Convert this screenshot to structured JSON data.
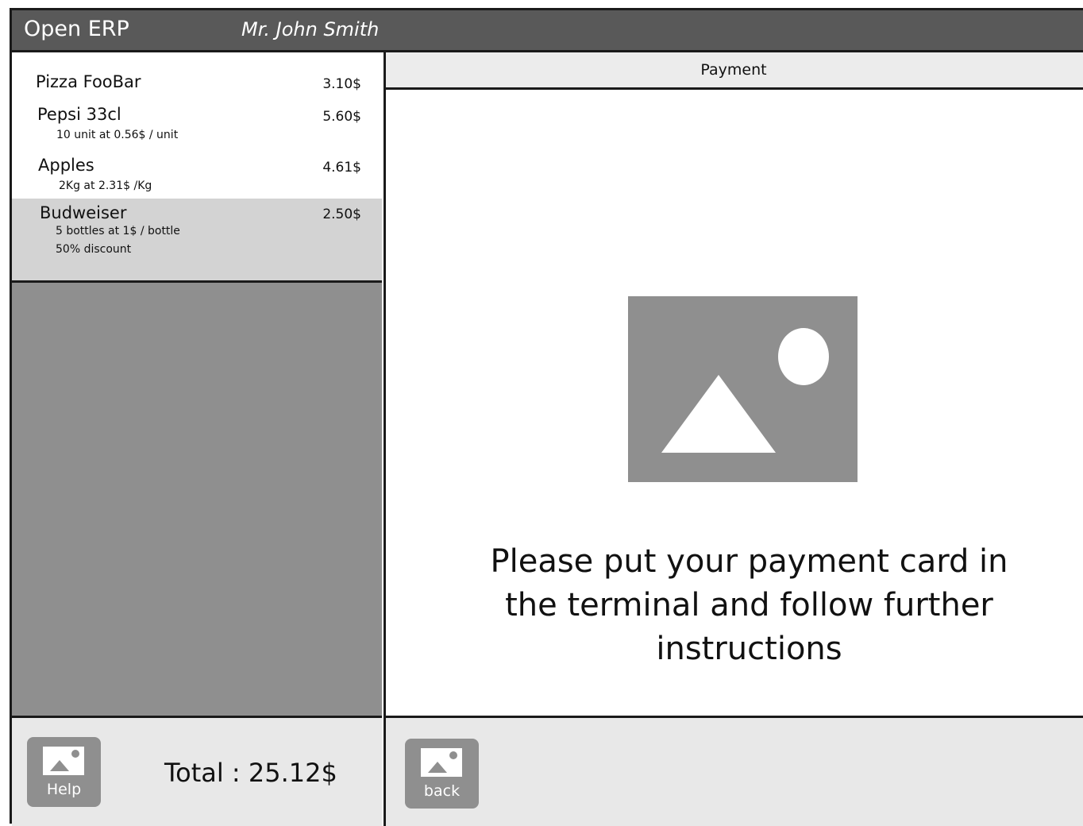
{
  "header": {
    "app_title": "Open ERP",
    "user_name": "Mr. John Smith"
  },
  "order": {
    "items": [
      {
        "name": "Pizza FooBar",
        "price": "3.10$",
        "details": []
      },
      {
        "name": "Pepsi 33cl",
        "price": "5.60$",
        "details": [
          "10 unit at 0.56$ / unit"
        ]
      },
      {
        "name": "Apples",
        "price": "4.61$",
        "details": [
          "2Kg at 2.31$ /Kg"
        ]
      },
      {
        "name": "Budweiser",
        "price": "2.50$",
        "details": [
          "5 bottles at 1$ / bottle",
          "50% discount"
        ],
        "selected": true
      }
    ],
    "total_label": "Total : 25.12$"
  },
  "footer": {
    "help_label": "Help",
    "back_label": "back"
  },
  "payment": {
    "title": "Payment",
    "image_icon": "image-placeholder-icon",
    "instructions": "Please put your payment card in the terminal and follow further instructions"
  },
  "colors": {
    "topbar": "#595959",
    "panel_gray": "#8f8f8f",
    "selected_row": "#d3d3d3",
    "footer_bg": "#e8e8e8",
    "header_bg": "#ececec",
    "border": "#1a1a1a"
  }
}
